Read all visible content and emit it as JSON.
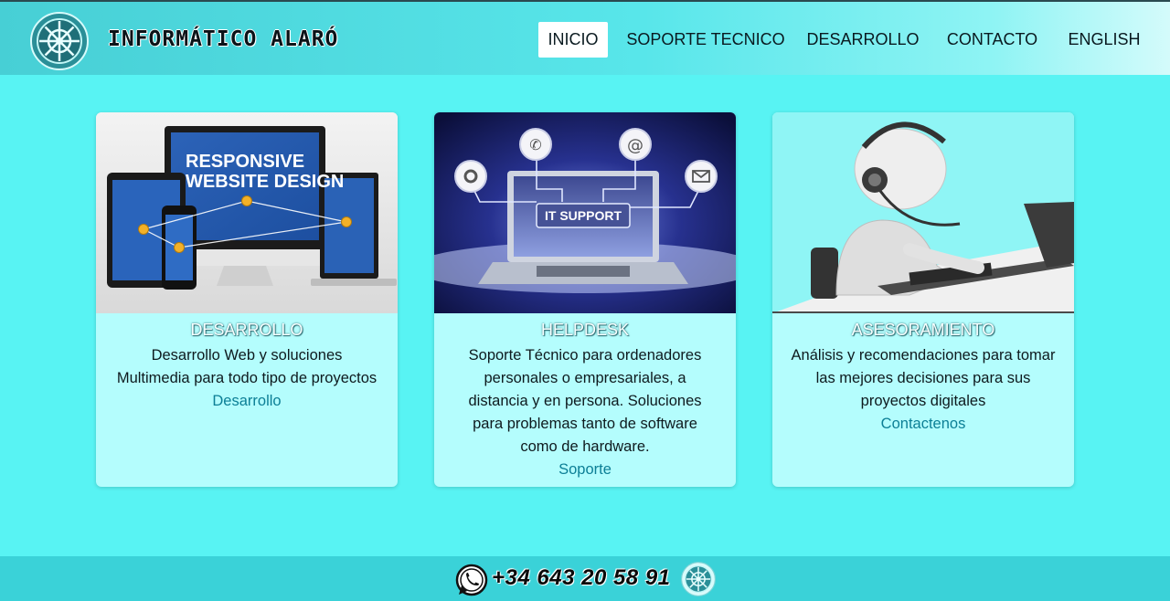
{
  "header": {
    "brand": "INFORMÁTICO ALARÓ",
    "logo_icon": "ship-wheel-logo-icon",
    "nav": [
      {
        "label": "INICIO",
        "active": true
      },
      {
        "label": "SOPORTE TECNICO",
        "active": false
      },
      {
        "label": "DESARROLLO",
        "active": false
      },
      {
        "label": "CONTACTO",
        "active": false
      },
      {
        "label": "ENGLISH",
        "active": false
      }
    ]
  },
  "cards": [
    {
      "image_text": [
        "RESPONSIVE",
        "WEBSITE DESIGN"
      ],
      "title": "DESARROLLO",
      "text": "Desarrollo Web y soluciones Multimedia para todo tipo de proyectos",
      "link": "Desarrollo"
    },
    {
      "image_text": [
        "IT SUPPORT"
      ],
      "title": "HELPDESK",
      "text": "Soporte Técnico para ordenadores personales o empresariales, a distancia y en persona. Soluciones para problemas tanto de software como de hardware.",
      "link": "Soporte"
    },
    {
      "image_text": [],
      "title": "ASESORAMIENTO",
      "text": "Análisis y recomendaciones para tomar las mejores decisiones para sus proyectos digitales",
      "link": "Contactenos"
    }
  ],
  "footer": {
    "phone": "+34 643 20 58 91",
    "whatsapp_icon": "whatsapp-icon"
  },
  "colors": {
    "page_bg": "#58f3f3",
    "card_bg": "#b4fdfd",
    "link": "#0c7f96",
    "footer_bg": "#3ad2d8"
  }
}
